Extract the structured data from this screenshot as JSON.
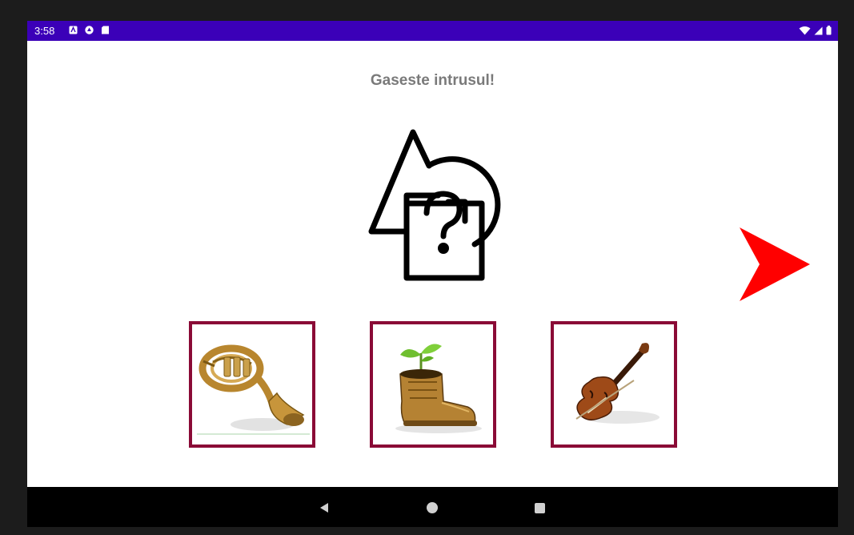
{
  "status_bar": {
    "time": "3:58",
    "background": "#3b00b8",
    "left_icons": [
      "app-notification-icon",
      "drive-icon",
      "sd-card-icon"
    ],
    "right_icons": [
      "wifi-icon",
      "signal-icon",
      "battery-icon"
    ]
  },
  "screen": {
    "title": "Gaseste intrusul!",
    "hero_icon": "shapes-question-icon",
    "next_icon": "next-arrow-icon",
    "next_color": "#ff0000",
    "choice_border_color": "#8a0a36",
    "choices": [
      {
        "icon": "french-horn-icon"
      },
      {
        "icon": "boot-with-plant-icon"
      },
      {
        "icon": "violin-icon"
      }
    ]
  },
  "nav_bar": {
    "back_icon": "back-triangle-icon",
    "home_icon": "home-circle-icon",
    "recents_icon": "recents-square-icon"
  }
}
